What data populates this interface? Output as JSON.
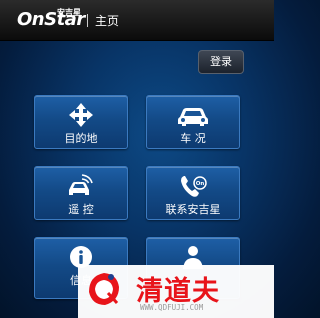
{
  "header": {
    "logo_text": "OnStar",
    "logo_cn": "安吉星",
    "title": "主页"
  },
  "login_label": "登录",
  "tiles": [
    {
      "label": "目的地",
      "icon": "destination-icon"
    },
    {
      "label": "车 况",
      "icon": "car-icon"
    },
    {
      "label": "遥 控",
      "icon": "remote-control-icon"
    },
    {
      "label": "联系安吉星",
      "icon": "phone-icon"
    },
    {
      "label": "信息",
      "icon": "info-icon"
    },
    {
      "label": "",
      "icon": "person-icon"
    }
  ],
  "watermark": {
    "name": "清道夫",
    "url": "WWW.QDFUJI.COM"
  },
  "colors": {
    "background": "#083466",
    "tile": "#134a87",
    "watermark_red": "#e8141a"
  }
}
